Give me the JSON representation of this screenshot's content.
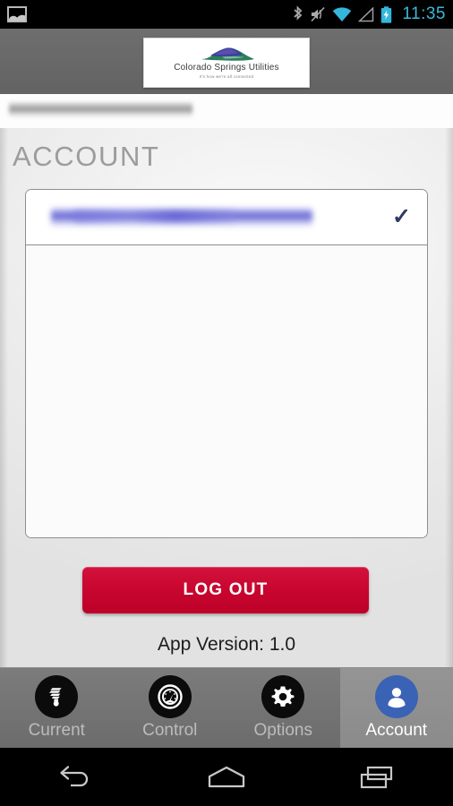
{
  "status_bar": {
    "time": "11:35",
    "left_icons": [
      {
        "name": "gallery-image-icon"
      }
    ],
    "right_icons": [
      {
        "name": "bluetooth-icon"
      },
      {
        "name": "volume-muted-icon"
      },
      {
        "name": "wifi-icon"
      },
      {
        "name": "cell-signal-icon"
      },
      {
        "name": "battery-charging-icon"
      }
    ],
    "colors": {
      "time": "#39b9d8",
      "background": "#000000"
    }
  },
  "header": {
    "logo": {
      "company": "Colorado Springs Utilities",
      "tagline": "It's how we're all connected",
      "mark": "mountain-logo-icon"
    },
    "band_color": "#6a6a6a"
  },
  "redacted_banner": {
    "text": "",
    "note": "blurred redacted account header text"
  },
  "main": {
    "page_title": "ACCOUNT",
    "title_color": "#9c9c9c",
    "account_list": {
      "rows": [
        {
          "label": "",
          "redacted": true,
          "selected": true,
          "check_glyph": "✓"
        }
      ]
    },
    "logout_label": "LOG OUT",
    "logout_color": "#c8062f",
    "app_version": "App Version: 1.0"
  },
  "tabbar": {
    "tabs": [
      {
        "label": "Current",
        "icon": "lightbulb-cfl-icon",
        "active": false
      },
      {
        "label": "Control",
        "icon": "gauge-icon",
        "active": false
      },
      {
        "label": "Options",
        "icon": "gear-icon",
        "active": false
      },
      {
        "label": "Account",
        "icon": "user-person-icon",
        "active": true
      }
    ],
    "active_color": "#3a62b5",
    "background_color": "#737373"
  },
  "navbar": {
    "buttons": [
      {
        "name": "back-button",
        "icon": "back-arrow-icon"
      },
      {
        "name": "home-button",
        "icon": "home-icon"
      },
      {
        "name": "recents-button",
        "icon": "recents-icon"
      }
    ]
  }
}
